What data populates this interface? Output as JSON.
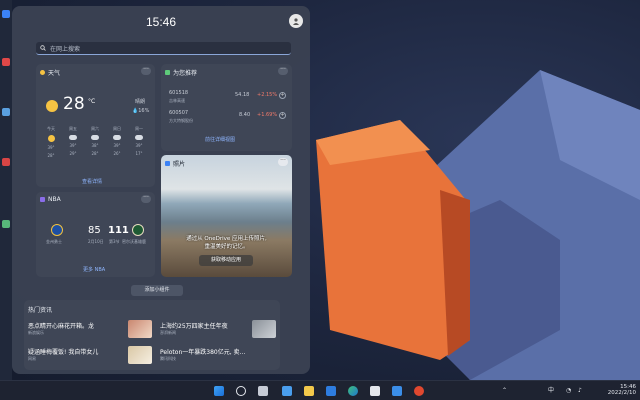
{
  "panel": {
    "time": "15:46",
    "search_placeholder": "在网上搜索",
    "add_widget": "添加小组件"
  },
  "weather": {
    "title": "天气",
    "temp": "28",
    "unit": "°C",
    "condition": "晴朗",
    "humidity": "16%",
    "link": "查看详情",
    "days": [
      {
        "day": "今天",
        "high": "39°",
        "low": "28°",
        "icon": "sun-icon"
      },
      {
        "day": "周五",
        "high": "39°",
        "low": "29°",
        "icon": "partly-cloudy-icon"
      },
      {
        "day": "周六",
        "high": "38°",
        "low": "28°",
        "icon": "partly-cloudy-icon"
      },
      {
        "day": "周日",
        "high": "39°",
        "low": "26°",
        "icon": "partly-cloudy-icon"
      },
      {
        "day": "周一",
        "high": "39°",
        "low": "17°",
        "icon": "partly-cloudy-icon"
      }
    ]
  },
  "stocks": {
    "title": "为您推荐",
    "link": "前往详细视图",
    "items": [
      {
        "code": "601518",
        "name": "吉林高速",
        "price": "54.18",
        "change": "+2.15%"
      },
      {
        "code": "600507",
        "name": "方大特钢股份",
        "price": "8.40",
        "change": "+1.69%"
      }
    ]
  },
  "nba": {
    "title": "NBA",
    "home_team": "金州勇士",
    "home_score": "85",
    "away_score": "111",
    "date": "2月10日",
    "status": "第3节",
    "away_team": "密尔沃基雄鹿",
    "link": "更多 NBA"
  },
  "photos": {
    "title": "照片",
    "message_line1": "通过从 OneDrive 应用上传照片,",
    "message_line2": "重温美好的记忆。",
    "button": "获取移动应用"
  },
  "news": {
    "title": "热门资讯",
    "items": [
      {
        "headline": "恶点睛开心麻花开箱。龙",
        "source": "新浪娱乐"
      },
      {
        "headline": "上海约25万四家主任年夜",
        "source": "澎湃新闻"
      },
      {
        "headline": "疑涵睡梅覆饭! 我自带女儿",
        "source": "网易"
      },
      {
        "headline": "Peloton一年暴跌380亿元, 卖...",
        "source": "腾讯科技"
      }
    ]
  },
  "taskbar": {
    "icons": [
      "windows-icon",
      "search-icon",
      "task-view-icon",
      "widgets-icon",
      "file-explorer-icon",
      "store-icon",
      "edge-icon",
      "office-icon",
      "onedrive-icon",
      "app-icon"
    ],
    "lang": "中",
    "clock_time": "15:46",
    "clock_date": "2022/2/10"
  },
  "colors": {
    "accent": "#8fb6ff",
    "stock_up": "#f27a6a",
    "desktop_orange": "#e8733a"
  }
}
